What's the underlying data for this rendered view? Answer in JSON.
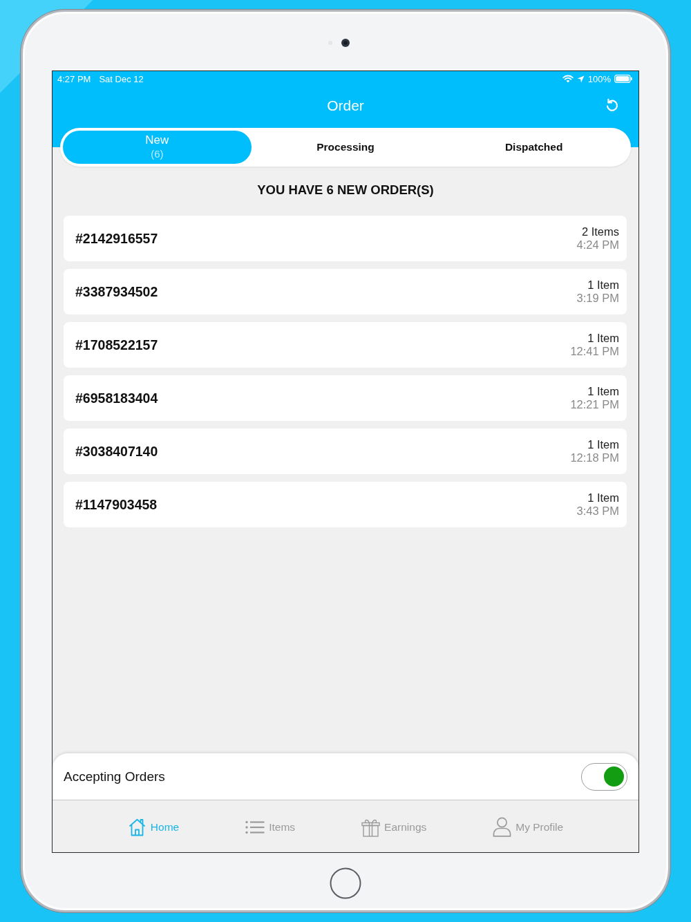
{
  "status_bar": {
    "time": "4:27 PM",
    "date": "Sat Dec 12",
    "battery_percent": "100%"
  },
  "nav_bar": {
    "title": "Order"
  },
  "tabs": [
    {
      "label": "New",
      "count": "(6)",
      "selected": true
    },
    {
      "label": "Processing",
      "selected": false
    },
    {
      "label": "Dispatched",
      "selected": false
    }
  ],
  "heading": "YOU HAVE 6 NEW ORDER(S)",
  "orders": [
    {
      "number": "#2142916557",
      "items": "2 Items",
      "time": "4:24 PM"
    },
    {
      "number": "#3387934502",
      "items": "1 Item",
      "time": "3:19 PM"
    },
    {
      "number": "#1708522157",
      "items": "1 Item",
      "time": "12:41 PM"
    },
    {
      "number": "#6958183404",
      "items": "1 Item",
      "time": "12:21 PM"
    },
    {
      "number": "#3038407140",
      "items": "1 Item",
      "time": "12:18 PM"
    },
    {
      "number": "#1147903458",
      "items": "1 Item",
      "time": "3:43 PM"
    }
  ],
  "accepting_orders": {
    "label": "Accepting Orders",
    "on": true
  },
  "bottom_nav": [
    {
      "label": "Home",
      "selected": true
    },
    {
      "label": "Items",
      "selected": false
    },
    {
      "label": "Earnings",
      "selected": false
    },
    {
      "label": "My Profile",
      "selected": false
    }
  ]
}
